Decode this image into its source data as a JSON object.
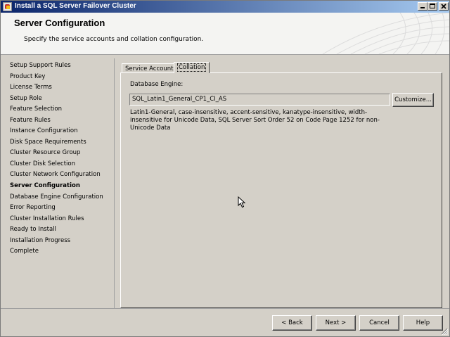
{
  "window": {
    "title": "Install a SQL Server Failover Cluster"
  },
  "header": {
    "title": "Server Configuration",
    "subtitle": "Specify the service accounts and collation configuration."
  },
  "nav": {
    "items": [
      {
        "label": "Setup Support Rules"
      },
      {
        "label": "Product Key"
      },
      {
        "label": "License Terms"
      },
      {
        "label": "Setup Role"
      },
      {
        "label": "Feature Selection"
      },
      {
        "label": "Feature Rules"
      },
      {
        "label": "Instance Configuration"
      },
      {
        "label": "Disk Space Requirements"
      },
      {
        "label": "Cluster Resource Group"
      },
      {
        "label": "Cluster Disk Selection"
      },
      {
        "label": "Cluster Network Configuration"
      },
      {
        "label": "Server Configuration",
        "current": true
      },
      {
        "label": "Database Engine Configuration"
      },
      {
        "label": "Error Reporting"
      },
      {
        "label": "Cluster Installation Rules"
      },
      {
        "label": "Ready to Install"
      },
      {
        "label": "Installation Progress"
      },
      {
        "label": "Complete"
      }
    ]
  },
  "tabs": {
    "service_accounts": "Service Accounts",
    "collation": "Collation"
  },
  "collation": {
    "engine_label": "Database Engine:",
    "value": "SQL_Latin1_General_CP1_CI_AS",
    "customize_label": "Customize...",
    "description": "Latin1-General, case-insensitive, accent-sensitive, kanatype-insensitive, width-insensitive for Unicode Data, SQL Server Sort Order 52 on Code Page 1252 for non-Unicode Data"
  },
  "buttons": {
    "back": "< Back",
    "next": "Next >",
    "cancel": "Cancel",
    "help": "Help"
  },
  "icons": [
    "sql-setup-app-icon",
    "minimize-icon",
    "maximize-icon",
    "close-icon",
    "resize-grip-icon",
    "mouse-pointer-icon"
  ]
}
